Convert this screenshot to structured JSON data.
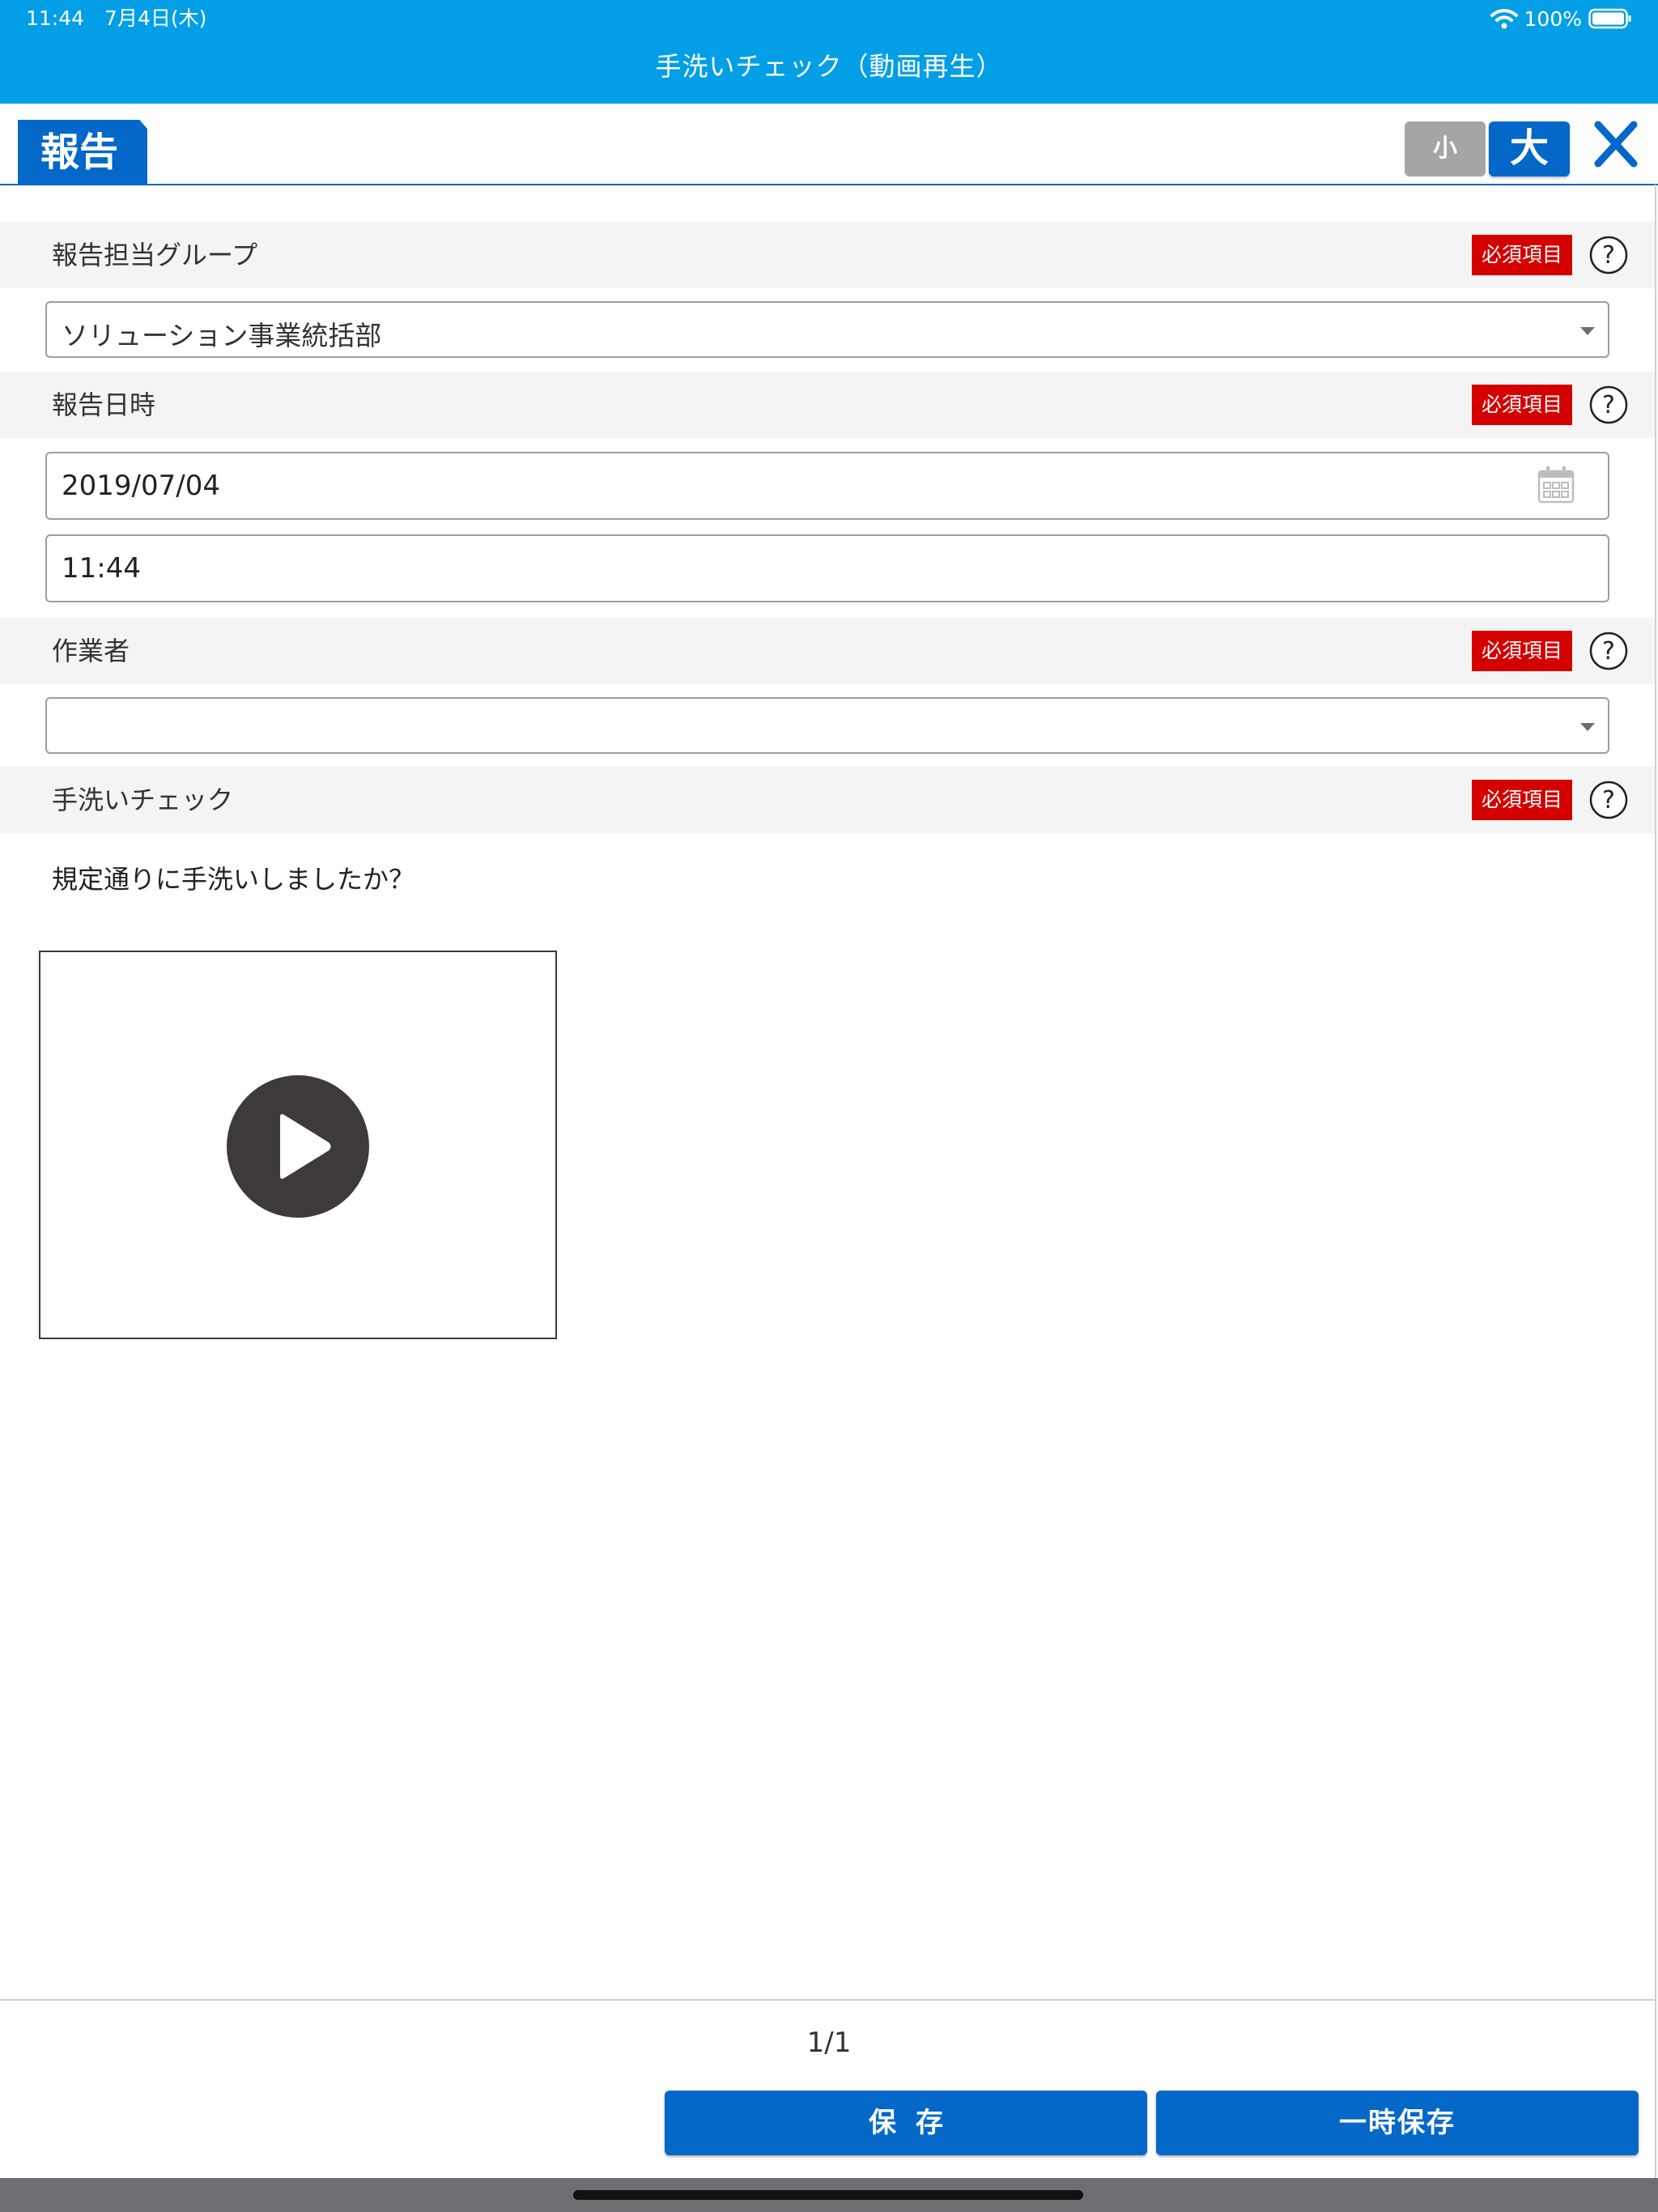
{
  "status_bar": {
    "time_date": "11:44　7月4日(木)",
    "battery": "100%"
  },
  "nav": {
    "title": "手洗いチェック（動画再生）"
  },
  "header": {
    "tab_label": "報告",
    "font_small_label": "小",
    "font_large_label": "大"
  },
  "required_label": "必須項目",
  "sections": {
    "group": {
      "label": "報告担当グループ",
      "value": "ソリューション事業統括部"
    },
    "datetime": {
      "label": "報告日時",
      "date_value": "2019/07/04",
      "time_value": "11:44"
    },
    "worker": {
      "label": "作業者",
      "value": ""
    },
    "handwash": {
      "label": "手洗いチェック",
      "question": "規定通りに手洗いしましたか？"
    }
  },
  "footer": {
    "page": "1/1",
    "save_label": "保存",
    "temp_save_label": "一時保存"
  },
  "colors": {
    "nav_bar": "#029fe6",
    "primary": "#0468c8",
    "required": "#d40000",
    "section_bg": "#f4f4f4"
  }
}
